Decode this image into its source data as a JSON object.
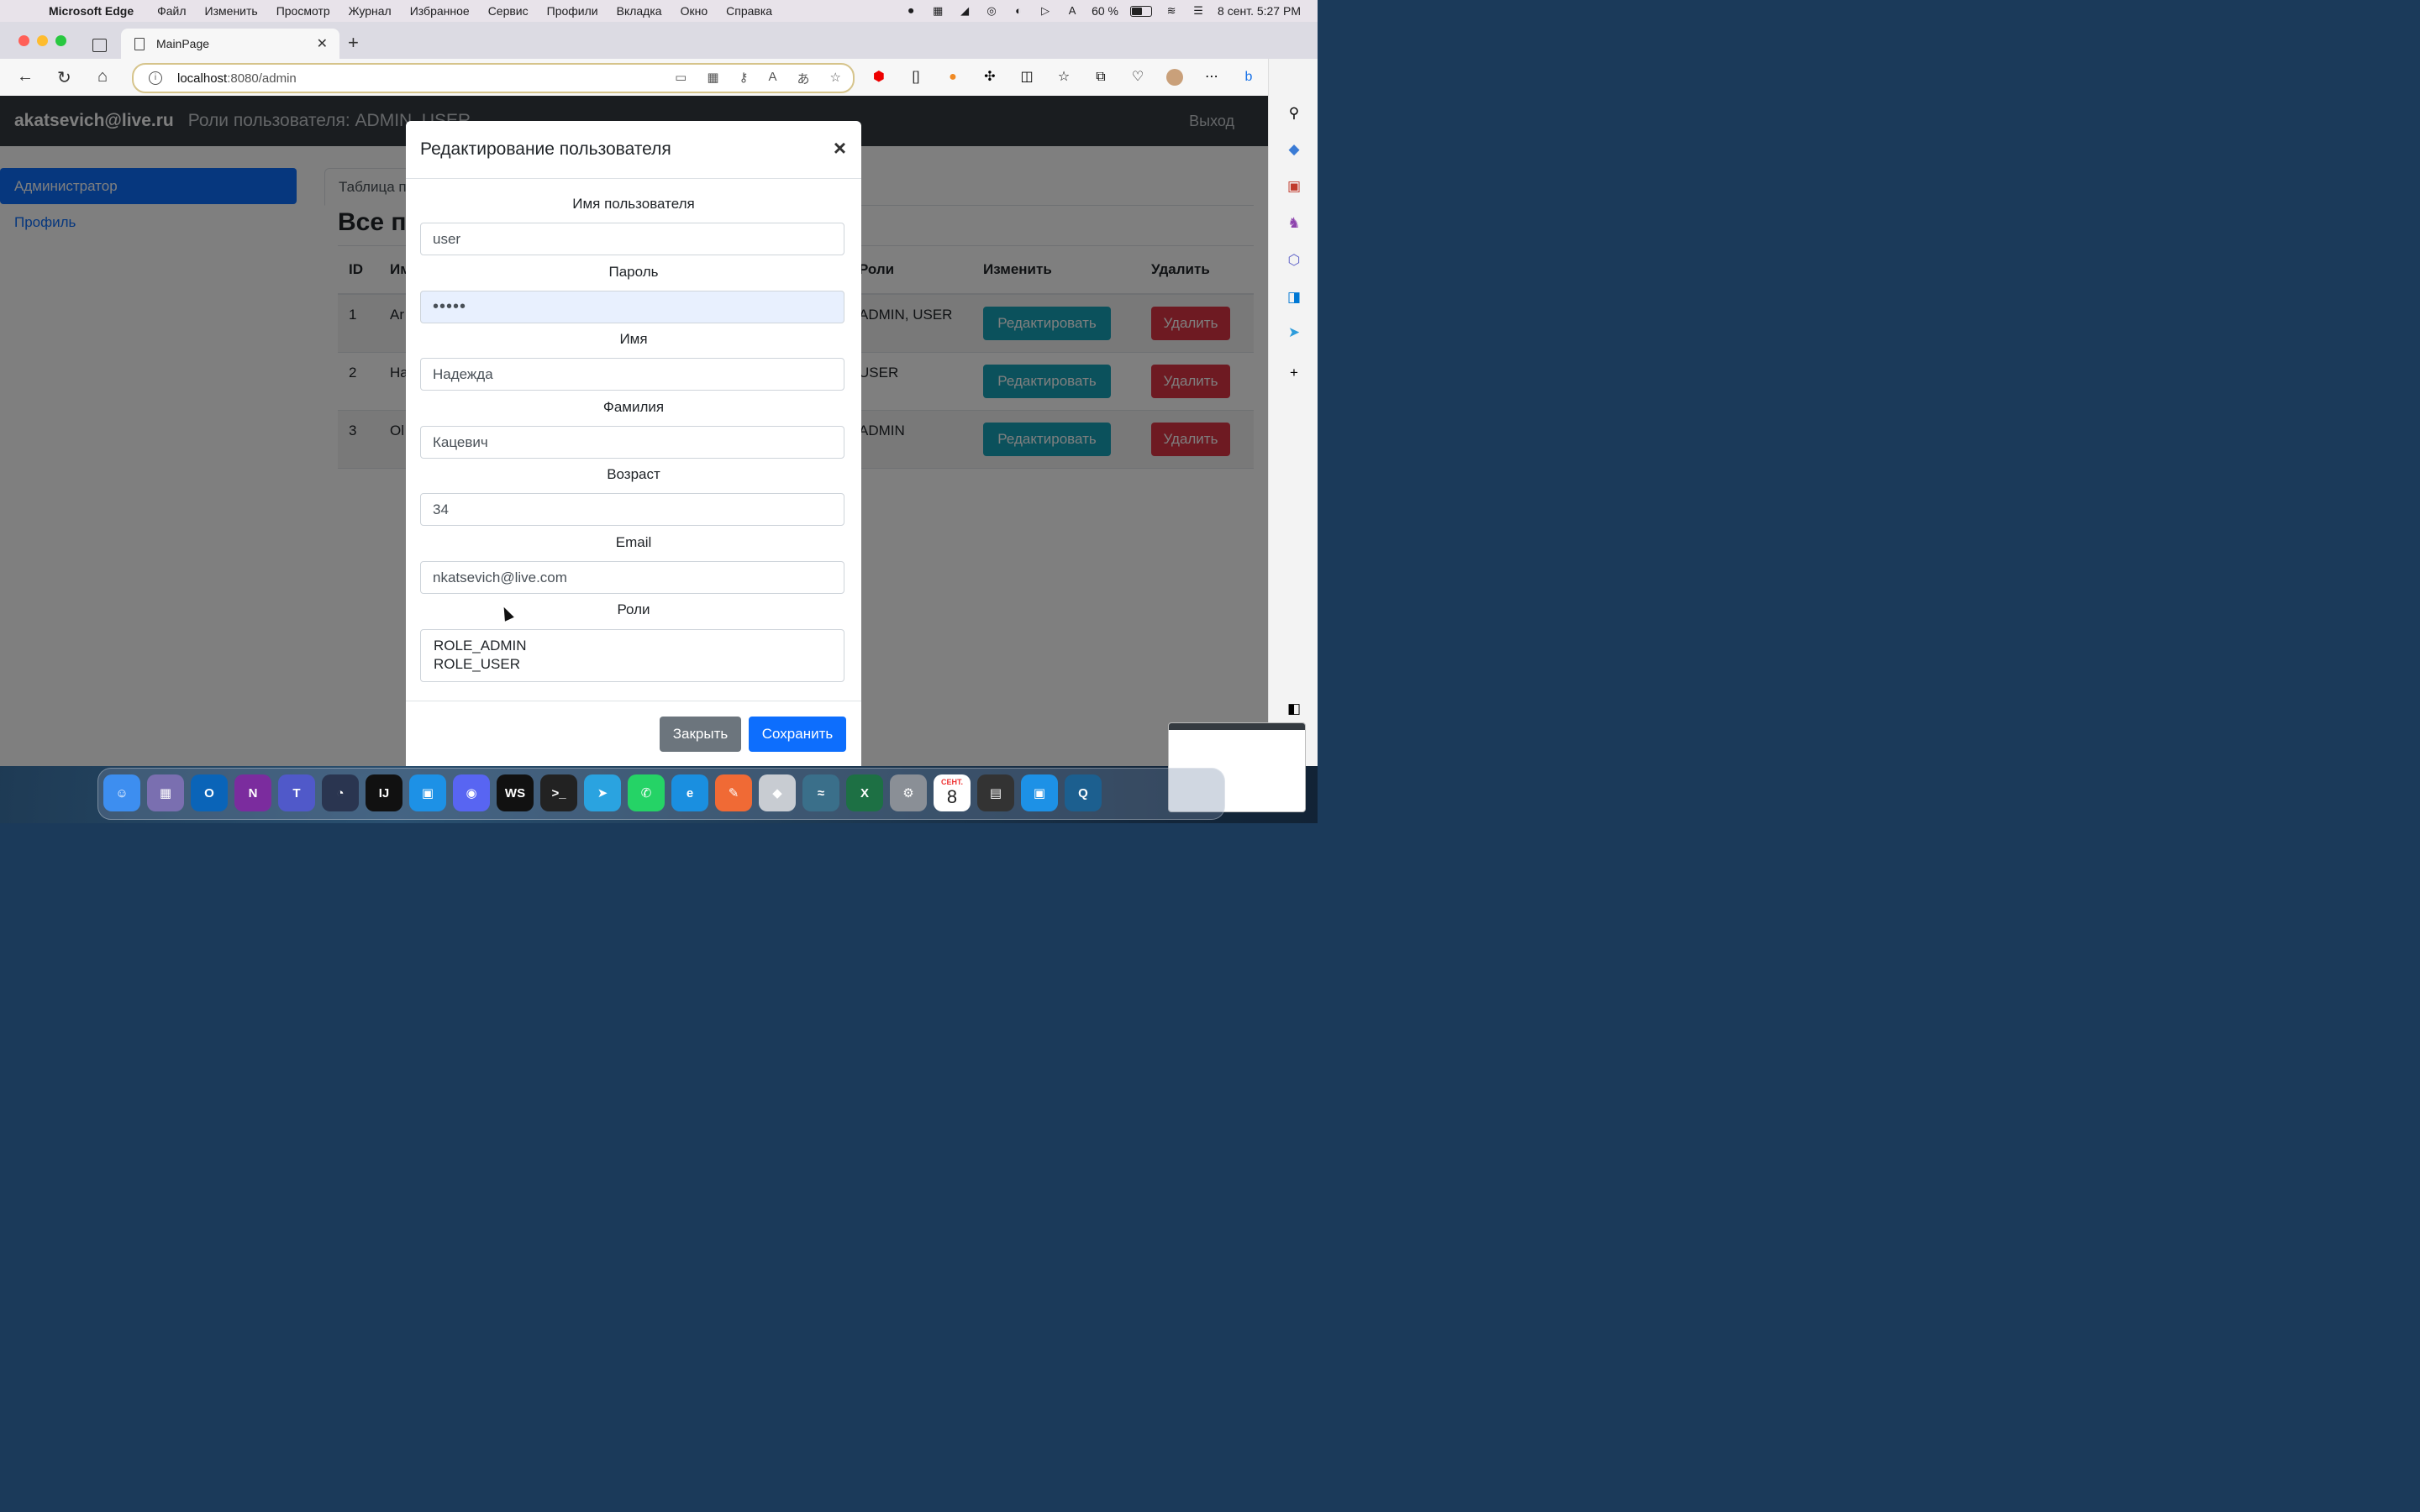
{
  "menubar": {
    "app_name": "Microsoft Edge",
    "items": [
      "Файл",
      "Изменить",
      "Просмотр",
      "Журнал",
      "Избранное",
      "Сервис",
      "Профили",
      "Вкладка",
      "Окно",
      "Справка"
    ],
    "battery": "60 %",
    "datetime": "8 сент. 5:27 PM"
  },
  "browser": {
    "tab_title": "MainPage",
    "url_host": "localhost",
    "url_path": ":8080/admin"
  },
  "navbar": {
    "user_email": "akatsevich@live.ru",
    "roles_text": "Роли пользователя: ADMIN, USER",
    "logout": "Выход"
  },
  "sidebar": {
    "items": [
      {
        "label": "Администратор",
        "active": true
      },
      {
        "label": "Профиль",
        "active": false
      }
    ]
  },
  "main": {
    "tab_label": "Таблица п",
    "heading": "Все по",
    "columns": {
      "id": "ID",
      "name": "Им",
      "roles": "Роли",
      "edit": "Изменить",
      "delete": "Удалить"
    },
    "rows": [
      {
        "id": "1",
        "name": "Ar",
        "roles": "ADMIN, USER"
      },
      {
        "id": "2",
        "name": "Ha",
        "roles": "USER"
      },
      {
        "id": "3",
        "name": "Ol",
        "roles": "ADMIN"
      }
    ],
    "edit_label": "Редактировать",
    "delete_label": "Удалить"
  },
  "modal": {
    "title": "Редактирование пользователя",
    "close": "×",
    "fields": {
      "username": {
        "label": "Имя пользователя",
        "value": "user"
      },
      "password": {
        "label": "Пароль",
        "value": "•••••"
      },
      "first_name": {
        "label": "Имя",
        "value": "Надежда"
      },
      "last_name": {
        "label": "Фамилия",
        "value": "Кацевич"
      },
      "age": {
        "label": "Возраст",
        "value": "34"
      },
      "email": {
        "label": "Email",
        "value": "nkatsevich@live.com"
      },
      "roles": {
        "label": "Роли",
        "options": [
          "ROLE_ADMIN",
          "ROLE_USER"
        ]
      }
    },
    "close_button": "Закрыть",
    "save_button": "Сохранить"
  },
  "dock": {
    "calendar_month": "СЕНТ.",
    "calendar_day": "8"
  },
  "colors": {
    "navbar": "#343a40",
    "primary": "#0d6efd",
    "info": "#17a2b8",
    "danger": "#dc3545",
    "secondary": "#6c757d"
  }
}
